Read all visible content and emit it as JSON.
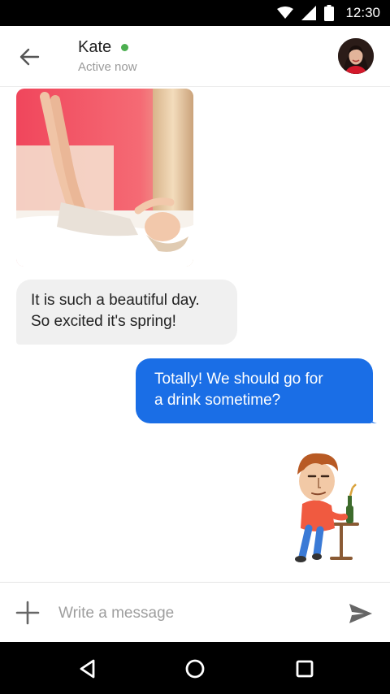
{
  "status_bar": {
    "time": "12:30",
    "icons": [
      "wifi-icon",
      "signal-icon",
      "battery-icon"
    ]
  },
  "header": {
    "contact_name": "Kate",
    "status": "Active now",
    "online_color": "#4caf50",
    "icons": [
      "back-arrow-icon",
      "avatar"
    ]
  },
  "messages": [
    {
      "type": "image",
      "direction": "incoming",
      "description_icon": "photo"
    },
    {
      "type": "text",
      "direction": "incoming",
      "line1": "It is such a beautiful day.",
      "line2": "So excited it's spring!"
    },
    {
      "type": "text",
      "direction": "outgoing",
      "line1": "Totally! We should go for",
      "line2": "a drink sometime?"
    },
    {
      "type": "sticker",
      "direction": "outgoing"
    }
  ],
  "composer": {
    "placeholder": "Write a message",
    "icons": [
      "plus-icon",
      "send-icon"
    ]
  },
  "nav_bar": {
    "icons": [
      "back-triangle-icon",
      "home-circle-icon",
      "recents-square-icon"
    ]
  },
  "colors": {
    "outgoing_bubble": "#1a6ee6",
    "incoming_bubble": "#f0f0f0",
    "accent": "#1a6ee6"
  }
}
